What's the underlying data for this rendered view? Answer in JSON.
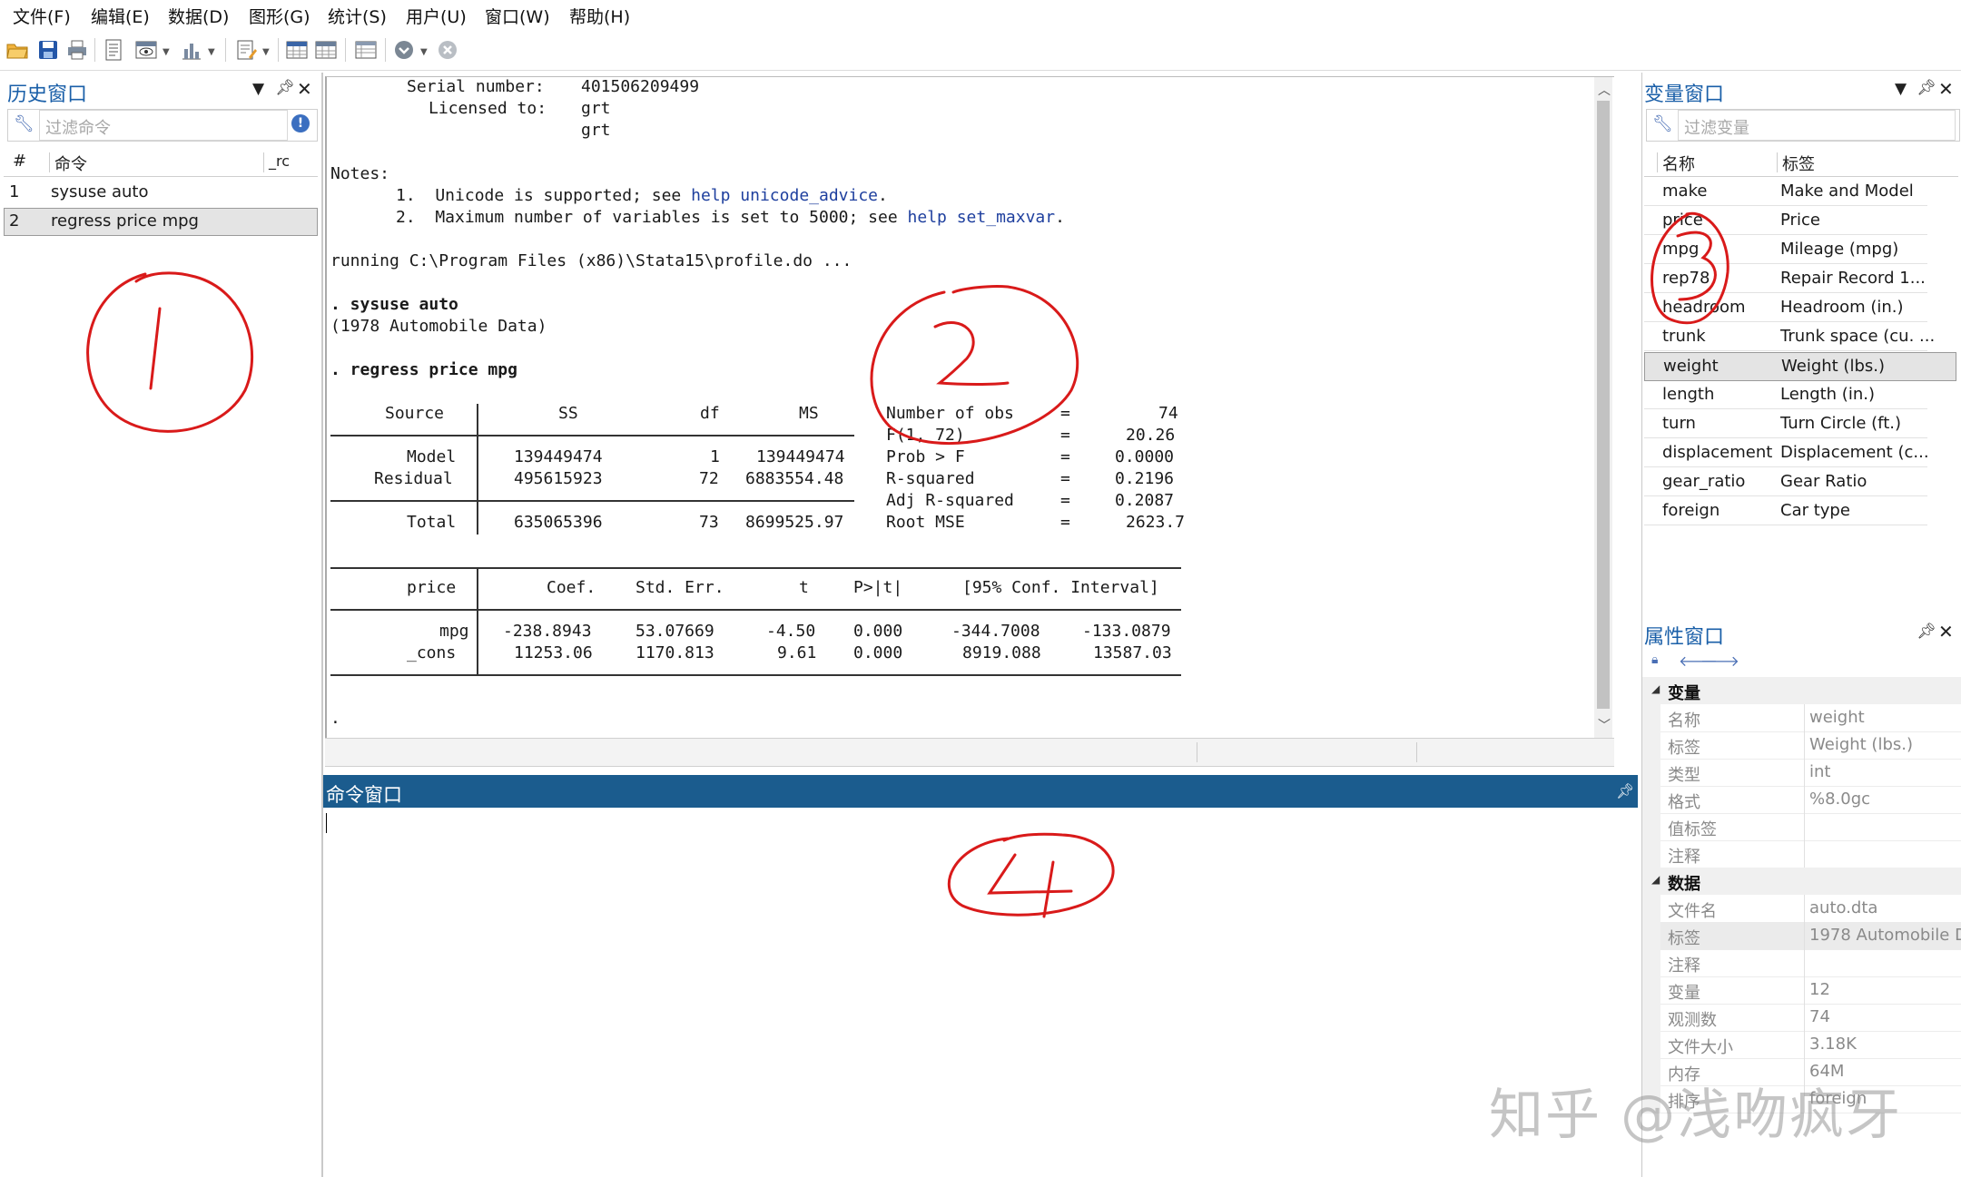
{
  "menu": [
    "文件(F)",
    "编辑(E)",
    "数据(D)",
    "图形(G)",
    "统计(S)",
    "用户(U)",
    "窗口(W)",
    "帮助(H)"
  ],
  "toolbar_icons": [
    "open-icon",
    "save-icon",
    "print-icon",
    "log-icon",
    "viewer-icon",
    "graph-icon",
    "do-editor-icon",
    "data-editor-icon",
    "data-browser-icon",
    "variables-manager-icon",
    "more-icon",
    "break-icon"
  ],
  "history": {
    "title": "历史窗口",
    "filter_placeholder": "过滤命令",
    "col_num": "#",
    "col_cmd": "命令",
    "col_rc": "_rc",
    "rows": [
      {
        "n": "1",
        "cmd": "sysuse auto"
      },
      {
        "n": "2",
        "cmd": "regress price mpg"
      }
    ]
  },
  "results": {
    "serial_label": "Serial number:",
    "serial_value": "401506209499",
    "licensed_label": "Licensed to:",
    "licensed_line1": "grt",
    "licensed_line2": "grt",
    "notes_label": "Notes:",
    "note1_pre": "1.  Unicode is supported; see ",
    "note1_link": "help unicode_advice",
    "note1_post": ".",
    "note2_pre": "2.  Maximum number of variables is set to 5000; see ",
    "note2_link": "help set_maxvar",
    "note2_post": ".",
    "running": "running C:\\Program Files (x86)\\Stata15\\profile.do ...",
    "cmd1": ". sysuse auto",
    "cmd1_out": "(1978 Automobile Data)",
    "cmd2": ". regress price mpg",
    "anova_headers": [
      "Source",
      "SS",
      "df",
      "MS"
    ],
    "anova_rows": [
      {
        "source": "Model",
        "ss": "139449474",
        "df": "1",
        "ms": "139449474"
      },
      {
        "source": "Residual",
        "ss": "495615923",
        "df": "72",
        "ms": "6883554.48"
      },
      {
        "source": "Total",
        "ss": "635065396",
        "df": "73",
        "ms": "8699525.97"
      }
    ],
    "stats": [
      {
        "label": "Number of obs",
        "eq": "=",
        "value": "74"
      },
      {
        "label": "F(1, 72)",
        "eq": "=",
        "value": "20.26"
      },
      {
        "label": "Prob > F",
        "eq": "=",
        "value": "0.0000"
      },
      {
        "label": "R-squared",
        "eq": "=",
        "value": "0.2196"
      },
      {
        "label": "Adj R-squared",
        "eq": "=",
        "value": "0.2087"
      },
      {
        "label": "Root MSE",
        "eq": "=",
        "value": "2623.7"
      }
    ],
    "coef_depvar": "price",
    "coef_headers": [
      "Coef.",
      "Std. Err.",
      "t",
      "P>|t|",
      "[95% Conf. Interval]"
    ],
    "coef_rows": [
      {
        "var": "mpg",
        "coef": "-238.8943",
        "se": "53.07669",
        "t": "-4.50",
        "p": "0.000",
        "lo": "-344.7008",
        "hi": "-133.0879"
      },
      {
        "var": "_cons",
        "coef": "11253.06",
        "se": "1170.813",
        "t": "9.61",
        "p": "0.000",
        "lo": "8919.088",
        "hi": "13587.03"
      }
    ],
    "prompt": "."
  },
  "command": {
    "title": "命令窗口"
  },
  "variables": {
    "title": "变量窗口",
    "filter_placeholder": "过滤变量",
    "col_name": "名称",
    "col_label": "标签",
    "rows": [
      {
        "name": "make",
        "label": "Make and Model"
      },
      {
        "name": "price",
        "label": "Price"
      },
      {
        "name": "mpg",
        "label": "Mileage (mpg)"
      },
      {
        "name": "rep78",
        "label": "Repair Record 1..."
      },
      {
        "name": "headroom",
        "label": "Headroom (in.)"
      },
      {
        "name": "trunk",
        "label": "Trunk space (cu. ..."
      },
      {
        "name": "weight",
        "label": "Weight (lbs.)"
      },
      {
        "name": "length",
        "label": "Length (in.)"
      },
      {
        "name": "turn",
        "label": "Turn Circle (ft.)"
      },
      {
        "name": "displacement",
        "label": "Displacement (c..."
      },
      {
        "name": "gear_ratio",
        "label": "Gear Ratio"
      },
      {
        "name": "foreign",
        "label": "Car type"
      }
    ]
  },
  "properties": {
    "title": "属性窗口",
    "sec_var": "变量",
    "var_props": [
      {
        "k": "名称",
        "v": "weight"
      },
      {
        "k": "标签",
        "v": "Weight (lbs.)"
      },
      {
        "k": "类型",
        "v": "int"
      },
      {
        "k": "格式",
        "v": "%8.0gc"
      },
      {
        "k": "值标签",
        "v": ""
      },
      {
        "k": "注释",
        "v": ""
      }
    ],
    "sec_data": "数据",
    "data_props": [
      {
        "k": "文件名",
        "v": "auto.dta"
      },
      {
        "k": "标签",
        "v": "1978 Automobile D"
      },
      {
        "k": "注释",
        "v": ""
      },
      {
        "k": "变量",
        "v": "12"
      },
      {
        "k": "观测数",
        "v": "74"
      },
      {
        "k": "文件大小",
        "v": "3.18K"
      },
      {
        "k": "内存",
        "v": "64M"
      },
      {
        "k": "排序",
        "v": "foreign"
      }
    ]
  },
  "annotations": [
    "1",
    "2",
    "3",
    "4"
  ],
  "watermark": "知乎 @浅吻疯牙",
  "colors": {
    "accent": "#1a5fa8",
    "command_bar": "#1b5c8e",
    "annotation": "#d91a1a",
    "link": "#1e3f9e"
  }
}
